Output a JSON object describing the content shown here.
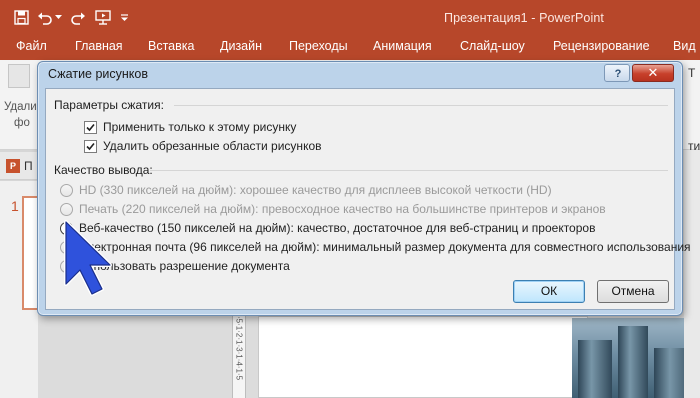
{
  "app": {
    "title": "Презентация1 - PowerPoint",
    "accent_color": "#b7472a"
  },
  "quick_access": {
    "save_icon": "save-icon",
    "undo_icon": "undo-icon",
    "undo_dropdown_icon": "chevron-down-icon",
    "redo_icon": "redo-icon",
    "present_icon": "start-slideshow-icon",
    "customize_icon": "customize-qat-icon"
  },
  "ribbon": {
    "tabs": [
      "Файл",
      "Главная",
      "Вставка",
      "Дизайн",
      "Переходы",
      "Анимация",
      "Слайд-шоу",
      "Рецензирование",
      "Вид"
    ],
    "left_group_text_1": "Удали",
    "left_group_text_2": "фо"
  },
  "thumbnails": {
    "header_label": "П",
    "slide_number": "1"
  },
  "right_edge": {
    "tab_letter": "Т",
    "side_label": "ти"
  },
  "ruler_marks": "·5·1·2·1·3·1·4·1·5",
  "dialog": {
    "title": "Сжатие рисунков",
    "help_label": "?",
    "close_label": "✕",
    "compression_group": "Параметры сжатия:",
    "checkboxes": [
      {
        "label": "Применить только к этому рисунку",
        "checked": true
      },
      {
        "label": "Удалить обрезанные области рисунков",
        "checked": true
      }
    ],
    "quality_group": "Качество вывода:",
    "radios": [
      {
        "label": "HD (330 пикселей на дюйм): хорошее качество для дисплеев высокой четкости (HD)",
        "selected": false,
        "disabled": true
      },
      {
        "label": "Печать (220 пикселей на дюйм): превосходное качество на большинстве принтеров и экранов",
        "selected": false,
        "disabled": true
      },
      {
        "label": "Веб-качество (150 пикселей на дюйм): качество, достаточное для веб-страниц и проекторов",
        "selected": true,
        "disabled": false
      },
      {
        "label": "Электронная почта (96 пикселей на дюйм): минимальный размер документа для совместного использования",
        "selected": false,
        "disabled": false
      },
      {
        "label": "Использовать разрешение документа",
        "selected": false,
        "disabled": false
      }
    ],
    "ok_label": "ОК",
    "cancel_label": "Отмена"
  }
}
